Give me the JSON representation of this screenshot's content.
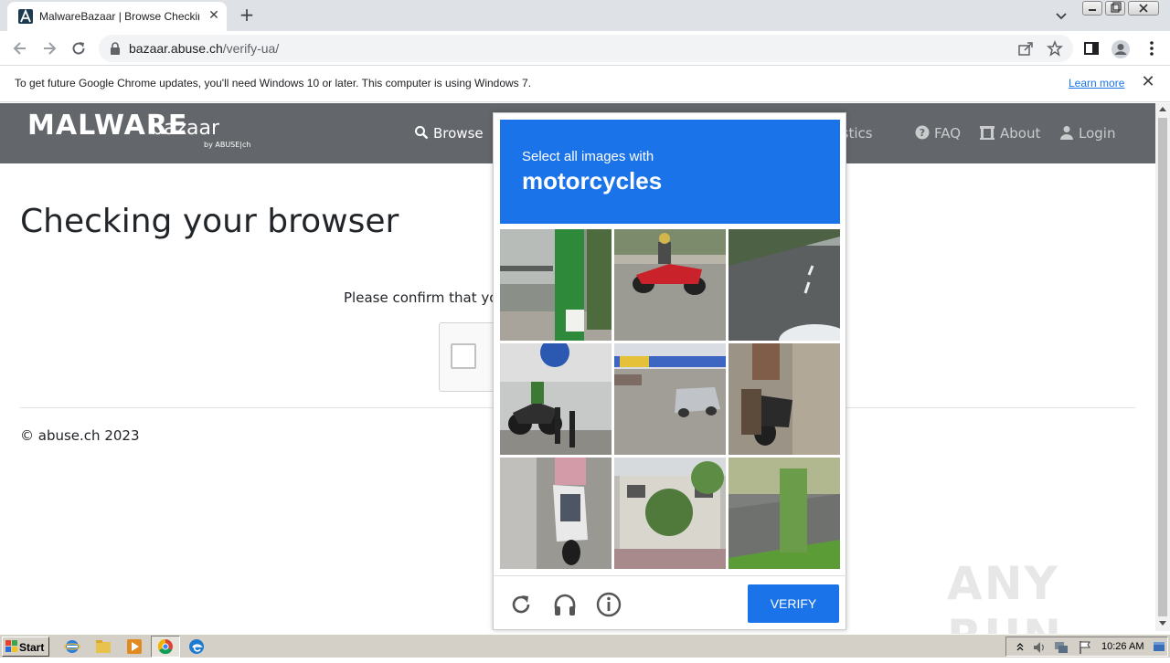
{
  "browser": {
    "tab_title": "MalwareBazaar | Browse Checking y",
    "url_host": "bazaar.abuse.ch",
    "url_path": "/verify-ua/",
    "infobar_text": "To get future Google Chrome updates, you'll need Windows 10 or later. This computer is using Windows 7.",
    "infobar_link": "Learn more"
  },
  "site": {
    "logo_main": "MALWARE",
    "logo_sub": "bazaar",
    "logo_by": "by ABUSE|ch",
    "nav": [
      {
        "label": "Browse",
        "icon": "search-icon"
      },
      {
        "label": "Statistics",
        "icon": "chart-icon"
      },
      {
        "label": "FAQ",
        "icon": "question-circle-icon"
      },
      {
        "label": "About",
        "icon": "building-icon"
      },
      {
        "label": "Login",
        "icon": "user-icon"
      }
    ],
    "heading": "Checking your browser",
    "confirm_text": "Please confirm that you",
    "footer": "© abuse.ch 2023"
  },
  "captcha": {
    "prompt": "Select all images with",
    "target": "motorcycles",
    "verify_label": "VERIFY",
    "tiles": [
      "street-sign-scene",
      "red-scooter-rider",
      "empty-road",
      "motorcycle-rider-street",
      "street-traffic",
      "person-on-scooter",
      "white-scooter-rider",
      "building-with-trees",
      "roadside-bush"
    ],
    "footer_icons": [
      "reload-icon",
      "headphones-icon",
      "info-icon"
    ]
  },
  "watermark": "ANY RUN",
  "taskbar": {
    "start_label": "Start",
    "clock": "10:26 AM"
  },
  "colors": {
    "captcha_blue": "#1a73e8",
    "site_nav": "#63676b"
  }
}
